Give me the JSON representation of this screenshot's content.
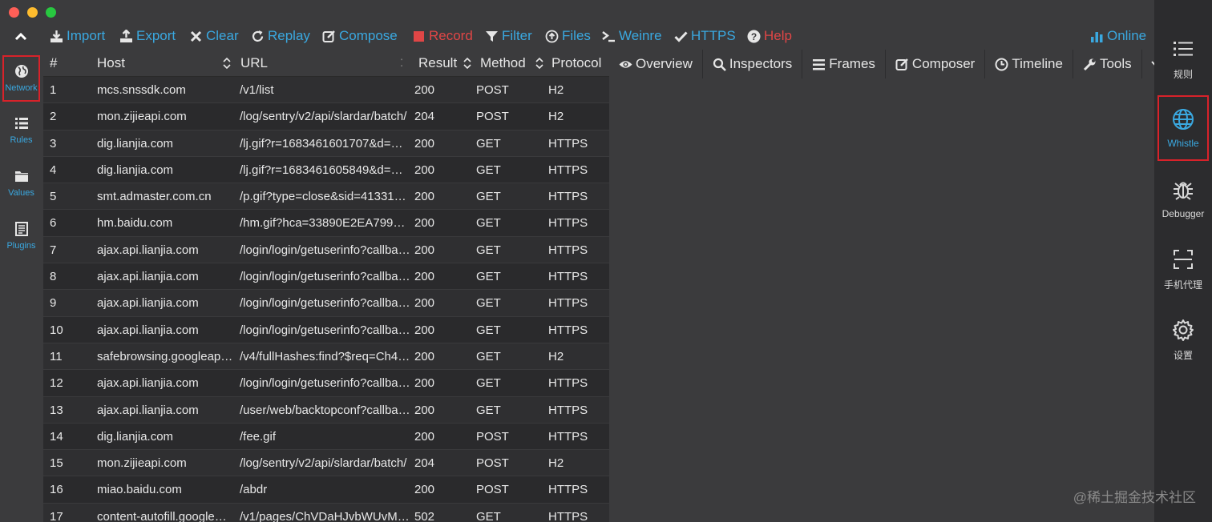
{
  "window": {
    "dot_colors": [
      "#fe5f57",
      "#febc2e",
      "#28c840"
    ]
  },
  "toolbar": {
    "items": [
      {
        "label": "Import",
        "icon": "import-icon",
        "color": "#3aa8e0"
      },
      {
        "label": "Export",
        "icon": "export-icon",
        "color": "#3aa8e0"
      },
      {
        "label": "Clear",
        "icon": "clear-icon",
        "color": "#3aa8e0"
      },
      {
        "label": "Replay",
        "icon": "replay-icon",
        "color": "#3aa8e0"
      },
      {
        "label": "Compose",
        "icon": "compose-icon",
        "color": "#3aa8e0"
      },
      {
        "label": "Record",
        "icon": "record-icon",
        "color": "#e04646"
      },
      {
        "label": "Filter",
        "icon": "filter-icon",
        "color": "#3aa8e0"
      },
      {
        "label": "Files",
        "icon": "files-icon",
        "color": "#3aa8e0"
      },
      {
        "label": "Weinre",
        "icon": "terminal-icon",
        "color": "#3aa8e0"
      },
      {
        "label": "HTTPS",
        "icon": "check-icon",
        "color": "#3aa8e0"
      },
      {
        "label": "Help",
        "icon": "help-icon",
        "color": "#e04646"
      }
    ],
    "online_label": "Online"
  },
  "leftnav": {
    "items": [
      {
        "label": "Network",
        "icon": "globe-icon"
      },
      {
        "label": "Rules",
        "icon": "list-icon"
      },
      {
        "label": "Values",
        "icon": "folder-icon"
      },
      {
        "label": "Plugins",
        "icon": "document-icon"
      }
    ]
  },
  "table": {
    "columns": [
      "#",
      "Host",
      "URL",
      "Result",
      "Method",
      "Protocol"
    ],
    "rows": [
      [
        "1",
        "mcs.snssdk.com",
        "/v1/list",
        "200",
        "POST",
        "H2"
      ],
      [
        "2",
        "mon.zijieapi.com",
        "/log/sentry/v2/api/slardar/batch/",
        "204",
        "POST",
        "H2"
      ],
      [
        "3",
        "dig.lianjia.com",
        "/lj.gif?r=1683461601707&d=%…",
        "200",
        "GET",
        "HTTPS"
      ],
      [
        "4",
        "dig.lianjia.com",
        "/lj.gif?r=1683461605849&d=%…",
        "200",
        "GET",
        "HTTPS"
      ],
      [
        "5",
        "smt.admaster.com.cn",
        "/p.gif?type=close&sid=41331c…",
        "200",
        "GET",
        "HTTPS"
      ],
      [
        "6",
        "hm.baidu.com",
        "/hm.gif?hca=33890E2EA799A…",
        "200",
        "GET",
        "HTTPS"
      ],
      [
        "7",
        "ajax.api.lianjia.com",
        "/login/login/getuserinfo?callba…",
        "200",
        "GET",
        "HTTPS"
      ],
      [
        "8",
        "ajax.api.lianjia.com",
        "/login/login/getuserinfo?callba…",
        "200",
        "GET",
        "HTTPS"
      ],
      [
        "9",
        "ajax.api.lianjia.com",
        "/login/login/getuserinfo?callba…",
        "200",
        "GET",
        "HTTPS"
      ],
      [
        "10",
        "ajax.api.lianjia.com",
        "/login/login/getuserinfo?callba…",
        "200",
        "GET",
        "HTTPS"
      ],
      [
        "11",
        "safebrowsing.googleapi…",
        "/v4/fullHashes:find?$req=Ch4…",
        "200",
        "GET",
        "H2"
      ],
      [
        "12",
        "ajax.api.lianjia.com",
        "/login/login/getuserinfo?callba…",
        "200",
        "GET",
        "HTTPS"
      ],
      [
        "13",
        "ajax.api.lianjia.com",
        "/user/web/backtopconf?callba…",
        "200",
        "GET",
        "HTTPS"
      ],
      [
        "14",
        "dig.lianjia.com",
        "/fee.gif",
        "200",
        "POST",
        "HTTPS"
      ],
      [
        "15",
        "mon.zijieapi.com",
        "/log/sentry/v2/api/slardar/batch/",
        "204",
        "POST",
        "H2"
      ],
      [
        "16",
        "miao.baidu.com",
        "/abdr",
        "200",
        "POST",
        "HTTPS"
      ],
      [
        "17",
        "content-autofill.googlea…",
        "/v1/pages/ChVDaHJvbWUvM…",
        "502",
        "GET",
        "HTTPS"
      ]
    ]
  },
  "detail": {
    "tabs": [
      {
        "label": "Overview",
        "icon": "eye-icon"
      },
      {
        "label": "Inspectors",
        "icon": "search-icon"
      },
      {
        "label": "Frames",
        "icon": "menu-icon"
      },
      {
        "label": "Composer",
        "icon": "compose-icon"
      },
      {
        "label": "Timeline",
        "icon": "clock-icon"
      },
      {
        "label": "Tools",
        "icon": "wrench-icon"
      }
    ]
  },
  "rightbar": {
    "items": [
      {
        "label": "规则",
        "icon": "list-icon"
      },
      {
        "label": "Whistle",
        "icon": "globe-icon"
      },
      {
        "label": "Debugger",
        "icon": "bug-icon"
      },
      {
        "label": "手机代理",
        "icon": "scan-icon"
      },
      {
        "label": "设置",
        "icon": "gear-icon"
      }
    ]
  },
  "watermark": "@稀土掘金技术社区",
  "accent_color": "#3aa8e0",
  "highlight_color": "#d8222a"
}
